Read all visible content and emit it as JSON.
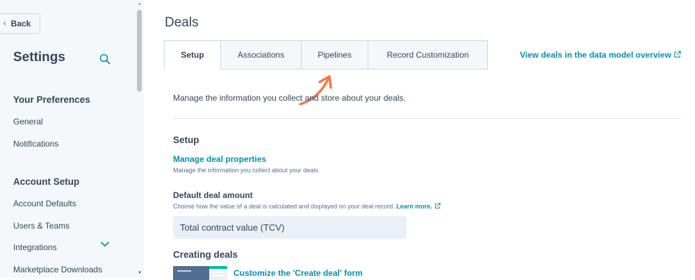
{
  "sidebar": {
    "back_label": "Back",
    "title": "Settings",
    "search_icon": "search-icon",
    "sections": [
      {
        "heading": "Your Preferences",
        "items": [
          "General",
          "Notifications"
        ]
      },
      {
        "heading": "Account Setup",
        "items": [
          "Account Defaults",
          "Users & Teams",
          "Integrations",
          "Marketplace Downloads"
        ]
      }
    ]
  },
  "main": {
    "page_title": "Deals",
    "tabs": [
      {
        "label": "Setup",
        "active": true
      },
      {
        "label": "Associations",
        "active": false
      },
      {
        "label": "Pipelines",
        "active": false
      },
      {
        "label": "Record Customization",
        "active": false
      }
    ],
    "view_link": "View deals in the data model overview",
    "intro": "Manage the information you collect and store about your deals.",
    "setup": {
      "heading": "Setup",
      "manage_link": "Manage deal properties",
      "manage_desc": "Manage the information you collect about your deals."
    },
    "default_amount": {
      "heading": "Default deal amount",
      "desc": "Choose how the value of a deal is calculated and displayed on your deal record.",
      "learn_more": "Learn more.",
      "selected_value": "Total contract value (TCV)"
    },
    "creating": {
      "heading": "Creating deals",
      "customize_link": "Customize the 'Create deal' form"
    }
  },
  "colors": {
    "accent_link": "#0091ae",
    "text": "#33475b",
    "sidebar_bg": "#f5f8fa",
    "annotation_arrow": "#f2784b"
  }
}
